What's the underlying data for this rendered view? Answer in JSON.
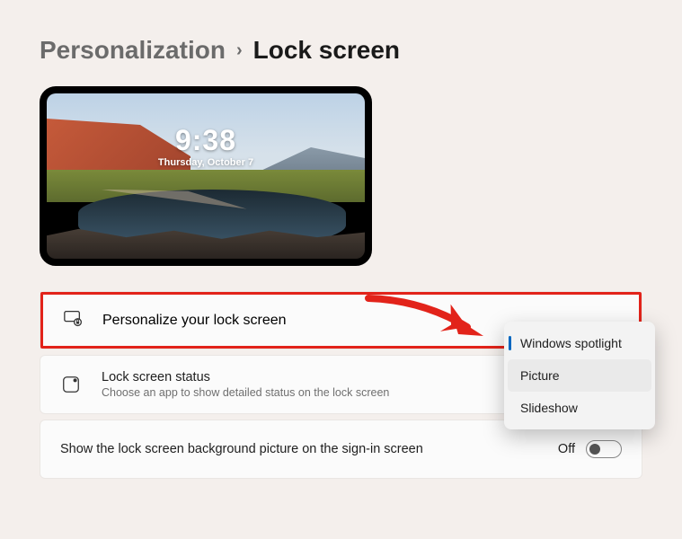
{
  "breadcrumb": {
    "parent": "Personalization",
    "current": "Lock screen"
  },
  "preview": {
    "time": "9:38",
    "date": "Thursday, October 7"
  },
  "cards": {
    "personalize": {
      "title": "Personalize your lock screen"
    },
    "status": {
      "title": "Lock screen status",
      "subtitle": "Choose an app to show detailed status on the lock screen"
    },
    "signin": {
      "label": "Show the lock screen background picture on the sign-in screen",
      "state_label": "Off"
    }
  },
  "dropdown": {
    "options": [
      "Windows spotlight",
      "Picture",
      "Slideshow"
    ],
    "selected_index": 0,
    "hovered_index": 1
  }
}
